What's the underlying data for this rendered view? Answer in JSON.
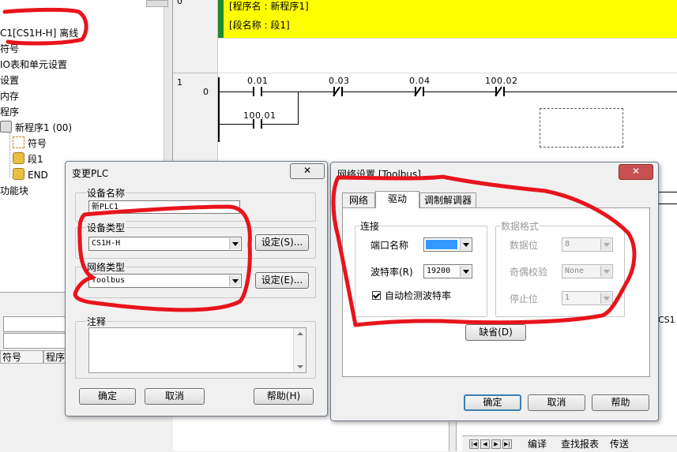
{
  "tree": {
    "plc_label": "C1[CS1H-H] 离线",
    "items": [
      "符号",
      "IO表和单元设置",
      "设置",
      "内存",
      "程序",
      "新程序1 (00)",
      "符号",
      "段1",
      "END",
      "功能块"
    ]
  },
  "lower_panel": {
    "col_symbol": "符号",
    "col_program": "程序"
  },
  "ladder": {
    "gutter_top": "0",
    "program_name": "[程序名 : 新程序1]",
    "section_name": "[段名称 : 段1]",
    "rung_number": "1",
    "rung_step": "0",
    "contacts": [
      "0.01",
      "0.03",
      "0.04",
      "100.02",
      "100.01"
    ],
    "right_label": "CS1"
  },
  "bottom_tabs": [
    "编译",
    "查找报表",
    "传送"
  ],
  "change_plc": {
    "title": "变更PLC",
    "close_label": "✕",
    "device_name_group": "设备名称",
    "device_name_value": "新PLC1",
    "device_type_group": "设备类型",
    "device_type_value": "CS1H-H",
    "device_type_settings": "设定(S)...",
    "network_type_group": "网络类型",
    "network_type_value": "Toolbus",
    "network_type_settings": "设定(E)...",
    "comment_group": "注释",
    "ok_button": "确定",
    "cancel_button": "取消",
    "help_button": "帮助(H)"
  },
  "network_settings": {
    "title": "网络设置 [Toolbus]",
    "close_label": "✕",
    "tabs": [
      "网络",
      "驱动",
      "调制解调器"
    ],
    "active_tab": "驱动",
    "connection_group": "连接",
    "port_label": "端口名称",
    "port_value": "",
    "baud_label": "波特率(R)",
    "baud_value": "19200",
    "autodetect_label": "自动检测波特率",
    "autodetect_checked": true,
    "data_format_group": "数据格式",
    "data_bits_label": "数据位",
    "data_bits_value": "8",
    "parity_label": "奇偶校验",
    "parity_value": "None",
    "stop_bits_label": "停止位",
    "stop_bits_value": "1",
    "default_button": "缺省(D)",
    "ok_button": "确定",
    "cancel_button": "取消",
    "help_button": "帮助"
  },
  "colors": {
    "annotation_red": "#e8141c",
    "section_header_yellow": "#ffff00",
    "section_marker_green": "#1f8a2a",
    "port_selection_blue": "#3399ff"
  }
}
